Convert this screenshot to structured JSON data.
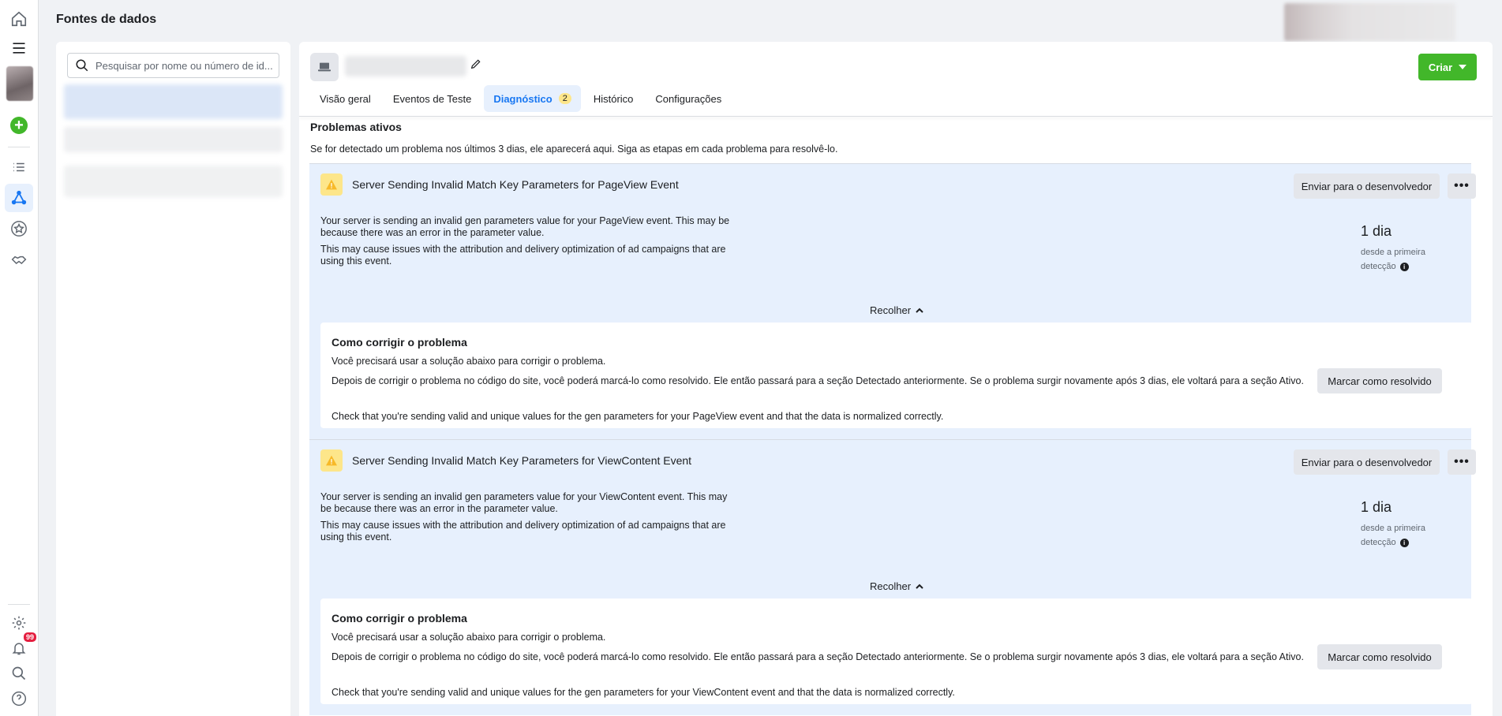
{
  "header": {
    "title": "Fontes de dados"
  },
  "rail": {
    "icons": [
      "home-icon",
      "menu-icon",
      "add-icon",
      "list-icon",
      "events-manager-icon",
      "star-icon",
      "handshake-icon",
      "settings-icon",
      "notifications-icon",
      "search-icon",
      "help-icon"
    ],
    "notification_count": "99",
    "accent": "#1877f2"
  },
  "left_panel": {
    "search_placeholder": "Pesquisar por nome ou número de id..."
  },
  "main": {
    "create_label": "Criar",
    "tabs": [
      {
        "label": "Visão geral"
      },
      {
        "label": "Eventos de Teste"
      },
      {
        "label": "Diagnóstico",
        "badge": "2"
      },
      {
        "label": "Histórico"
      },
      {
        "label": "Configurações"
      }
    ],
    "section_title": "Problemas ativos",
    "section_desc": "Se for detectado um problema nos últimos 3 dias, ele aparecerá aqui. Siga as etapas em cada problema para resolvê-lo.",
    "issues": [
      {
        "title": "Server Sending Invalid Match Key Parameters for PageView Event",
        "send_label": "Enviar para o desenvolvedor",
        "more_label": "•••",
        "desc1": "Your server is sending an invalid gen parameters value for your PageView event. This may be because there was an error in the parameter value.",
        "desc2": "This may cause issues with the attribution and delivery optimization of ad campaigns that are using this event.",
        "days": "1 dia",
        "days_sub": "desde a primeira detecção",
        "collapse_label": "Recolher",
        "fix_title": "Como corrigir o problema",
        "fix_line1": "Você precisará usar a solução abaixo para corrigir o problema.",
        "fix_line2": "Depois de corrigir o problema no código do site, você poderá marcá-lo como resolvido. Ele então passará para a seção Detectado anteriormente. Se o problema surgir novamente após 3 dias, ele voltará para a seção Ativo.",
        "fix_line3": "Check that you're sending valid and unique values for the gen parameters for your PageView event and that the data is normalized correctly.",
        "resolve_label": "Marcar como resolvido"
      },
      {
        "title": "Server Sending Invalid Match Key Parameters for ViewContent Event",
        "send_label": "Enviar para o desenvolvedor",
        "more_label": "•••",
        "desc1": "Your server is sending an invalid gen parameters value for your ViewContent event. This may be because there was an error in the parameter value.",
        "desc2": "This may cause issues with the attribution and delivery optimization of ad campaigns that are using this event.",
        "days": "1 dia",
        "days_sub": "desde a primeira detecção",
        "collapse_label": "Recolher",
        "fix_title": "Como corrigir o problema",
        "fix_line1": "Você precisará usar a solução abaixo para corrigir o problema.",
        "fix_line2": "Depois de corrigir o problema no código do site, você poderá marcá-lo como resolvido. Ele então passará para a seção Detectado anteriormente. Se o problema surgir novamente após 3 dias, ele voltará para a seção Ativo.",
        "fix_line3": "Check that you're sending valid and unique values for the gen parameters for your ViewContent event and that the data is normalized correctly.",
        "resolve_label": "Marcar como resolvido"
      }
    ]
  }
}
